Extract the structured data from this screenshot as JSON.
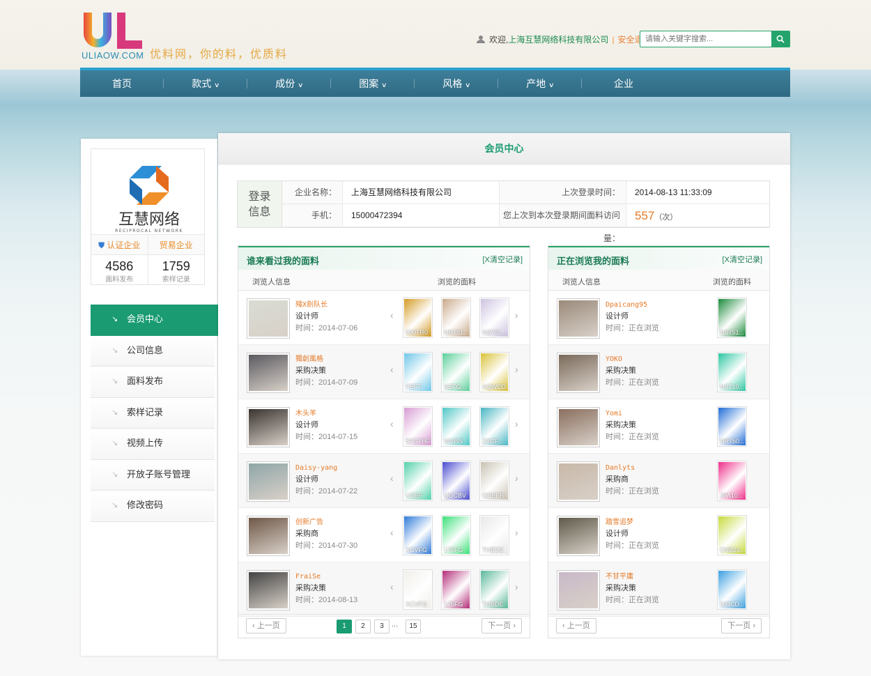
{
  "brand": {
    "domain": "ULIAOW.COM",
    "slogan": "优料网，你的料，优质料"
  },
  "userbar": {
    "welcome": "欢迎,",
    "company": "上海互慧网络科技有限公司",
    "separator": "|",
    "logout": "安全退出"
  },
  "search": {
    "placeholder": "请输入关键字搜索..."
  },
  "nav": [
    {
      "label": "首页",
      "dropdown": false
    },
    {
      "label": "款式",
      "dropdown": true
    },
    {
      "label": "成份",
      "dropdown": true
    },
    {
      "label": "图案",
      "dropdown": true
    },
    {
      "label": "风格",
      "dropdown": true
    },
    {
      "label": "产地",
      "dropdown": true
    },
    {
      "label": "企业",
      "dropdown": false
    }
  ],
  "company_card": {
    "name": "互慧网络",
    "sub": "RECIPROCAL NETWORK",
    "badge1": "认证企业",
    "badge2": "贸易企业",
    "stat1_value": "4586",
    "stat1_label": "面料发布",
    "stat2_value": "1759",
    "stat2_label": "索样记录"
  },
  "menu": [
    "会员中心",
    "公司信息",
    "面料发布",
    "索样记录",
    "视频上传",
    "开放子账号管理",
    "修改密码"
  ],
  "main_title": "会员中心",
  "login_info": {
    "tag1": "登录",
    "tag2": "信息",
    "company_label": "企业名称：",
    "company_value": "上海互慧网络科技有限公司",
    "phone_label": "手机：",
    "phone_value": "15000472394",
    "last_login_label": "上次登录时间：",
    "last_login_value": "2014-08-13 11:33:09",
    "visits_label": "您上次到本次登录期间面料访问量：",
    "visits_value": "557",
    "visits_unit": "（次）"
  },
  "left_panel": {
    "title": "谁来看过我的面料",
    "clear": "[X清空记录]",
    "col1": "浏览人信息",
    "col2": "浏览的面料",
    "rows": [
      {
        "name": "殘X劍队长",
        "role": "设计师",
        "time": "时间：2014-07-06",
        "avatar": "#d9dcd4",
        "swatches": [
          {
            "code": "000TR0",
            "color": "#d39a24"
          },
          {
            "code": "NR751...",
            "color": "#c9a98a"
          },
          {
            "code": "NS751...",
            "color": "#cdc3e0"
          }
        ]
      },
      {
        "name": "獨創風格",
        "role": "采购决策",
        "time": "时间：2014-07-09",
        "avatar": "#5b5a60",
        "swatches": [
          {
            "code": "FEFT",
            "color": "#6fc6e8"
          },
          {
            "code": "SEFG...",
            "color": "#5bcf9a"
          },
          {
            "code": "AQWED",
            "color": "#d9c23a"
          }
        ]
      },
      {
        "name": "木头羊",
        "role": "设计师",
        "time": "时间：2014-07-15",
        "avatar": "#3a3430",
        "swatches": [
          {
            "code": "5FGTHF",
            "color": "#d79ad2"
          },
          {
            "code": "WVBN",
            "color": "#4fc7c5"
          },
          {
            "code": "ZXCF...",
            "color": "#47b5c2"
          }
        ]
      },
      {
        "name": "Daisy-yang",
        "role": "设计师",
        "time": "时间：2014-07-22",
        "avatar": "#8fa6a8",
        "swatches": [
          {
            "code": "UDEF",
            "color": "#52d0a9"
          },
          {
            "code": "QDCBV",
            "color": "#4a4bd0"
          },
          {
            "code": "ODEFR",
            "color": "#c9c2b2"
          }
        ]
      },
      {
        "name": "创新广告",
        "role": "采购商",
        "time": "时间：2014-07-30",
        "avatar": "#6f5848",
        "swatches": [
          {
            "code": "XCVFG",
            "color": "#2f7ad9"
          },
          {
            "code": "175FG",
            "color": "#3de07a"
          },
          {
            "code": "THBDE",
            "color": "#e8e8e8"
          }
        ]
      },
      {
        "name": "FraiSe",
        "role": "采购决策",
        "time": "时间：2014-08-13",
        "avatar": "#444444",
        "swatches": [
          {
            "code": "XCVFG",
            "color": "#f0efea"
          },
          {
            "code": "175FG",
            "color": "#b32c78"
          },
          {
            "code": "THBDE",
            "color": "#59b89a"
          }
        ]
      }
    ],
    "prev": "上一页",
    "next": "下一页",
    "pages": [
      "1",
      "2",
      "3",
      "15"
    ],
    "ellipsis": "..."
  },
  "right_panel": {
    "title": "正在浏览我的面料",
    "clear": "[X清空记录]",
    "col1": "浏览人信息",
    "col2": "浏览的面料",
    "rows": [
      {
        "name": "Dpaicang95",
        "role": "设计师",
        "time": "时间：正在浏览",
        "avatar": "#9a8a7a",
        "swatches": [
          {
            "code": "NS751...",
            "color": "#1a8a3a"
          }
        ]
      },
      {
        "name": "YOKO",
        "role": "采购决策",
        "time": "时间：正在浏览",
        "avatar": "#7a6a5a",
        "swatches": [
          {
            "code": "NS710...",
            "color": "#2dc7a2"
          }
        ]
      },
      {
        "name": "Yomi",
        "role": "采购决策",
        "time": "时间：正在浏览",
        "avatar": "#8a6f5f",
        "swatches": [
          {
            "code": "NR750...",
            "color": "#1f6bd6"
          }
        ]
      },
      {
        "name": "Danlyts",
        "role": "采购商",
        "time": "时间：正在浏览",
        "avatar": "#c8b8a8",
        "swatches": [
          {
            "code": "JPA10...",
            "color": "#ef2d8a"
          }
        ]
      },
      {
        "name": "踏雪追梦",
        "role": "设计师",
        "time": "时间：正在浏览",
        "avatar": "#5f5a4a",
        "swatches": [
          {
            "code": "CNB24...",
            "color": "#c6da3c"
          }
        ]
      },
      {
        "name": "不甘平庸",
        "role": "采购决策",
        "time": "时间：正在浏览",
        "avatar": "#c9b9c9",
        "swatches": [
          {
            "code": "003CD...",
            "color": "#3ba0e0"
          }
        ]
      }
    ],
    "prev": "上一页",
    "next": "下一页"
  }
}
